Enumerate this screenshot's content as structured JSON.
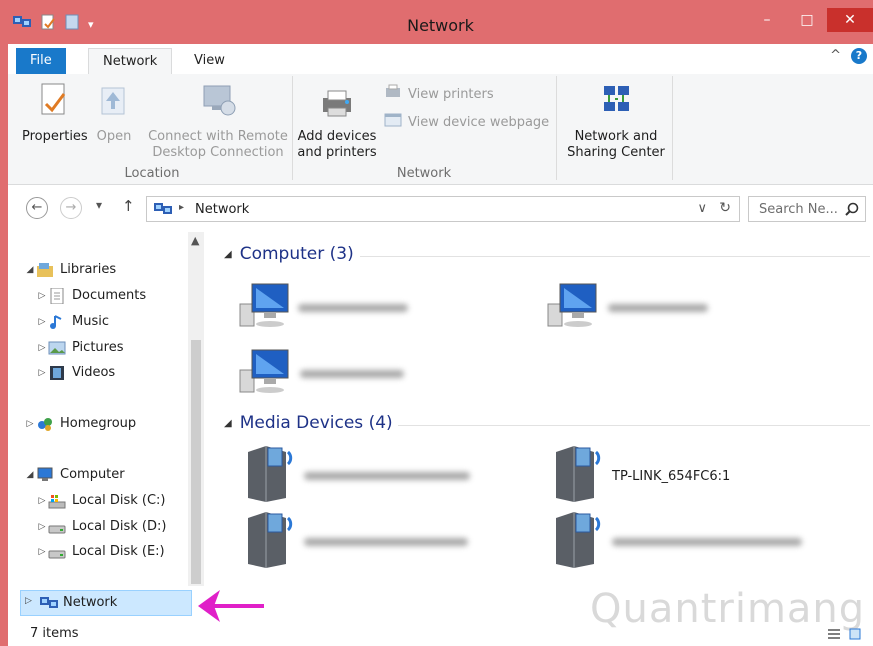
{
  "window": {
    "title": "Network",
    "controls": {
      "minimize": "–",
      "maximize": "□",
      "close": "✕"
    }
  },
  "ribbon_tabs": {
    "file": "File",
    "network": "Network",
    "view": "View"
  },
  "ribbon_controls": {
    "collapse": "^",
    "help": "?"
  },
  "ribbon": {
    "location": {
      "label": "Location",
      "properties": "Properties",
      "open": "Open",
      "connect_line1": "Connect with Remote",
      "connect_line2": "Desktop Connection"
    },
    "network": {
      "label": "Network",
      "add_line1": "Add devices",
      "add_line2": "and printers",
      "view_printers": "View printers",
      "view_webpage": "View device webpage"
    },
    "sharing": {
      "line1": "Network and",
      "line2": "Sharing Center"
    }
  },
  "address": {
    "back": "←",
    "forward": "→",
    "recent": "▾",
    "up": "↑",
    "crumb_sep": "▸",
    "path": "Network",
    "dropdown": "∨",
    "refresh": "↻",
    "search_placeholder": "Search Ne...",
    "search_icon": "magnifier-icon"
  },
  "nav": {
    "libraries": "Libraries",
    "documents": "Documents",
    "music": "Music",
    "pictures": "Pictures",
    "videos": "Videos",
    "homegroup": "Homegroup",
    "computer": "Computer",
    "disk_c": "Local Disk (C:)",
    "disk_d": "Local Disk (D:)",
    "disk_e": "Local Disk (E:)",
    "network": "Network"
  },
  "content": {
    "computers_header": "Computer (3)",
    "media_header": "Media Devices (4)",
    "tplink": "TP-LINK_654FC6:1"
  },
  "status": {
    "items": "7 items"
  },
  "watermark": "Quantrimang",
  "colors": {
    "accent": "#1979ca",
    "titlebar": "#e06d6f",
    "group_header": "#1e3287",
    "selection": "#cce8ff",
    "annotation_arrow": "#e020c8"
  }
}
